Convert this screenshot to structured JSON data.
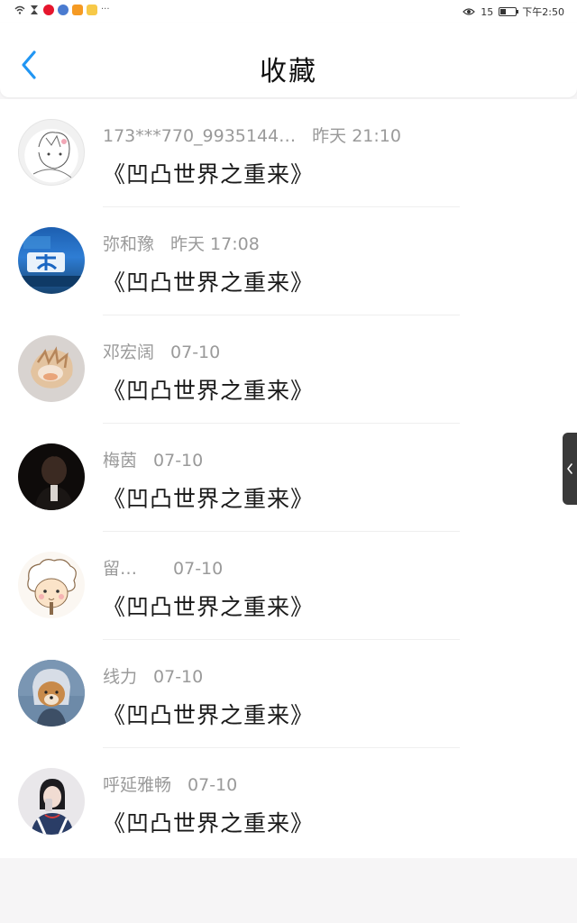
{
  "status_bar": {
    "time": "下午2:50",
    "speed": "15",
    "more_indicator": "···",
    "icons": [
      "wifi-icon",
      "hourglass-icon",
      "weibo-icon",
      "app-icon",
      "video-icon",
      "notes-icon",
      "eye-icon",
      "battery-icon"
    ]
  },
  "header": {
    "title": "收藏",
    "back_icon": "chevron-left-icon",
    "accent_color": "#2196f3"
  },
  "items": [
    {
      "name": "173***770_9935144…",
      "time": "昨天 21:10",
      "title": "《凹凸世界之重来》"
    },
    {
      "name": "弥和豫",
      "time": "昨天 17:08",
      "title": "《凹凸世界之重来》"
    },
    {
      "name": "邓宏阔",
      "time": "07-10",
      "title": "《凹凸世界之重来》"
    },
    {
      "name": "梅茵",
      "time": "07-10",
      "title": "《凹凸世界之重来》"
    },
    {
      "name": "留…",
      "time": "07-10",
      "title": "《凹凸世界之重来》"
    },
    {
      "name": "线力",
      "time": "07-10",
      "title": "《凹凸世界之重来》"
    },
    {
      "name": "呼延雅畅",
      "time": "07-10",
      "title": "《凹凸世界之重来》"
    }
  ],
  "side_handle": {
    "icon": "chevron-left-small-icon"
  }
}
